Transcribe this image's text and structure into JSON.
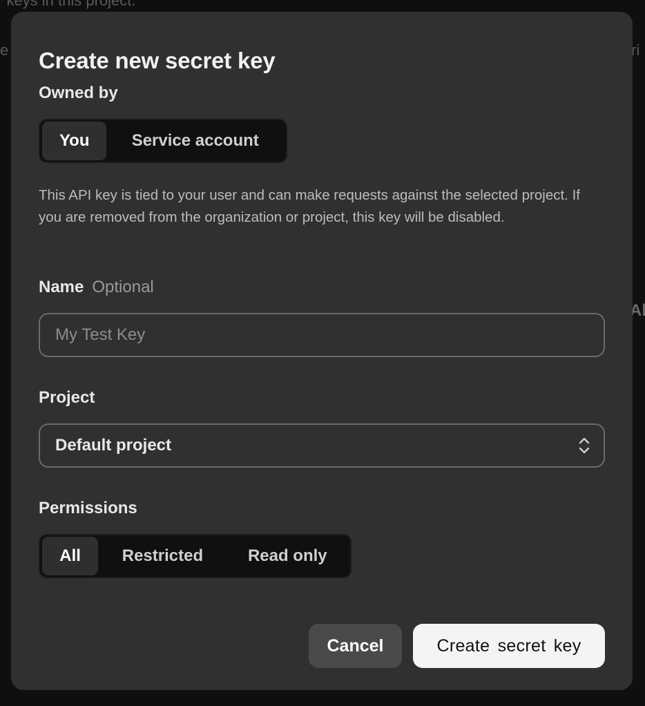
{
  "background": {
    "top_text": "r keys in this project.",
    "left_fragment": "e",
    "right_fragment": "ri",
    "right_fragment2": "Al"
  },
  "modal": {
    "title": "Create new secret key",
    "owned_by": {
      "label": "Owned by",
      "options": [
        "You",
        "Service account"
      ],
      "selected": "You"
    },
    "helper_text": "This API key is tied to your user and can make requests against the selected project. If you are removed from the organization or project, this key will be disabled.",
    "name": {
      "label": "Name",
      "optional_label": "Optional",
      "value": "",
      "placeholder": "My Test Key"
    },
    "project": {
      "label": "Project",
      "selected": "Default project",
      "icon": "chevron-up-down-icon"
    },
    "permissions": {
      "label": "Permissions",
      "options": [
        "All",
        "Restricted",
        "Read only"
      ],
      "selected": "All"
    },
    "actions": {
      "cancel_label": "Cancel",
      "create_label": "Create secret key"
    }
  },
  "colors": {
    "overlay": "#0f0f0f",
    "modal": "#303030",
    "primary_button": "#f4f4f4",
    "secondary_button": "#4a4a4a"
  }
}
